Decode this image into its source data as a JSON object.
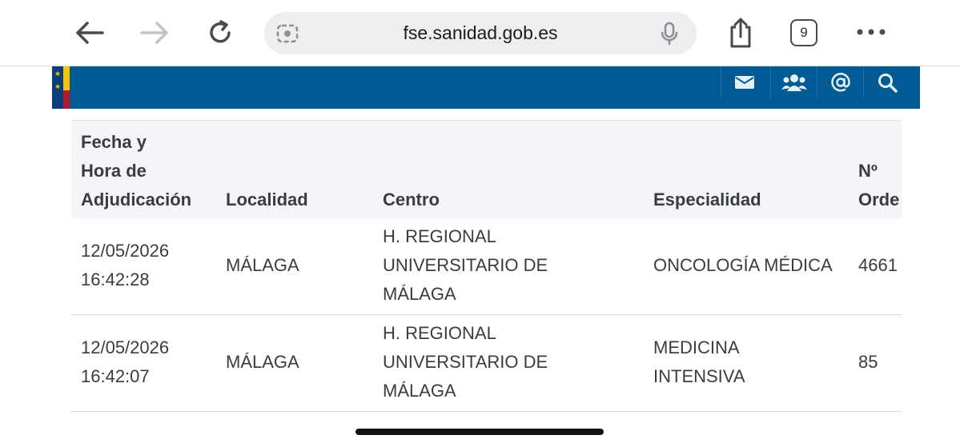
{
  "browser": {
    "url": "fse.sanidad.gob.es",
    "tab_count": "9"
  },
  "table": {
    "headers": {
      "fecha_line1": "Fecha y",
      "fecha_line2": "Hora de",
      "fecha_line3": "Adjudicación",
      "localidad": "Localidad",
      "centro": "Centro",
      "especialidad": "Especialidad",
      "orden_line1": "Nº",
      "orden_line2": "Orde"
    },
    "rows": [
      {
        "fecha": "12/05/2026",
        "hora": "16:42:28",
        "localidad": "MÁLAGA",
        "centro_line1": "H. REGIONAL",
        "centro_line2": "UNIVERSITARIO DE",
        "centro_line3": "MÁLAGA",
        "especialidad_line1": "ONCOLOGÍA MÉDICA",
        "especialidad_line2": "",
        "orden": "4661"
      },
      {
        "fecha": "12/05/2026",
        "hora": "16:42:07",
        "localidad": "MÁLAGA",
        "centro_line1": "H. REGIONAL",
        "centro_line2": "UNIVERSITARIO DE",
        "centro_line3": "MÁLAGA",
        "especialidad_line1": "MEDICINA",
        "especialidad_line2": "INTENSIVA",
        "orden": "85"
      }
    ]
  },
  "colors": {
    "header_blue": "#005a94",
    "table_header_bg": "#f3f5f8"
  },
  "icons": [
    "back-icon",
    "forward-icon",
    "reload-icon",
    "lens-icon",
    "mic-icon",
    "share-icon",
    "more-icon",
    "mail-icon",
    "users-icon",
    "at-icon",
    "search-icon"
  ]
}
